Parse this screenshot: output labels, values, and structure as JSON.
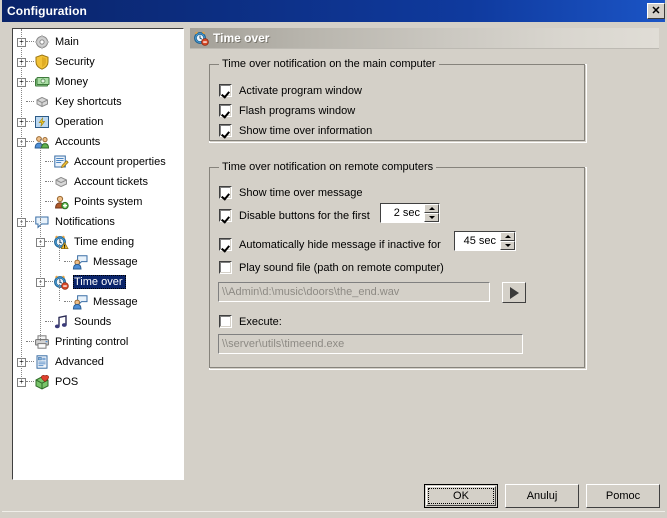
{
  "window": {
    "title": "Configuration",
    "close_label": "✕"
  },
  "tree": {
    "items": [
      {
        "label": "Main",
        "indent": 0,
        "expander": "+",
        "icon": "gear-icon",
        "selected": false
      },
      {
        "label": "Security",
        "indent": 0,
        "expander": "+",
        "icon": "shield-icon",
        "selected": false
      },
      {
        "label": "Money",
        "indent": 0,
        "expander": "+",
        "icon": "money-icon",
        "selected": false
      },
      {
        "label": "Key shortcuts",
        "indent": 0,
        "expander": "",
        "icon": "keyboard-icon",
        "selected": false
      },
      {
        "label": "Operation",
        "indent": 0,
        "expander": "+",
        "icon": "lightning-icon",
        "selected": false
      },
      {
        "label": "Accounts",
        "indent": 0,
        "expander": "-",
        "icon": "users-icon",
        "selected": false
      },
      {
        "label": "Account properties",
        "indent": 1,
        "expander": "",
        "icon": "edit-document-icon",
        "selected": false
      },
      {
        "label": "Account tickets",
        "indent": 1,
        "expander": "",
        "icon": "ticket-icon",
        "selected": false
      },
      {
        "label": "Points system",
        "indent": 1,
        "expander": "",
        "icon": "user-add-icon",
        "selected": false
      },
      {
        "label": "Notifications",
        "indent": 0,
        "expander": "-",
        "icon": "speech-bubble-icon",
        "selected": false
      },
      {
        "label": "Time ending",
        "indent": 1,
        "expander": "-",
        "icon": "alarm-warning-icon",
        "selected": false
      },
      {
        "label": "Message",
        "indent": 2,
        "expander": "",
        "icon": "user-message-icon",
        "selected": false
      },
      {
        "label": "Time over",
        "indent": 1,
        "expander": "-",
        "icon": "alarm-stop-icon",
        "selected": true
      },
      {
        "label": "Message",
        "indent": 2,
        "expander": "",
        "icon": "user-message-icon",
        "selected": false
      },
      {
        "label": "Sounds",
        "indent": 1,
        "expander": "",
        "icon": "music-note-icon",
        "selected": false
      },
      {
        "label": "Printing control",
        "indent": 0,
        "expander": "",
        "icon": "printer-icon",
        "selected": false
      },
      {
        "label": "Advanced",
        "indent": 0,
        "expander": "+",
        "icon": "advanced-list-icon",
        "selected": false
      },
      {
        "label": "POS",
        "indent": 0,
        "expander": "+",
        "icon": "pos-box-icon",
        "selected": false
      }
    ]
  },
  "pane": {
    "header_title": "Time over",
    "header_icon": "alarm-stop-icon",
    "group_main": {
      "title": "Time over notification on the main computer",
      "options": [
        {
          "label": "Activate program window",
          "checked": true
        },
        {
          "label": "Flash programs window",
          "checked": true
        },
        {
          "label": "Show time over information",
          "checked": true
        }
      ]
    },
    "group_remote": {
      "title": "Time over notification on remote computers",
      "show_message": {
        "label": "Show time over message",
        "checked": true
      },
      "disable_buttons": {
        "label": "Disable buttons for the first",
        "checked": true,
        "value": "2 sec"
      },
      "auto_hide": {
        "label": "Automatically hide message if inactive for",
        "checked": true,
        "value": "45 sec"
      },
      "play_sound": {
        "label": "Play sound file (path on remote computer)",
        "checked": false,
        "value": "\\\\Admin\\d:\\music\\doors\\the_end.wav"
      },
      "play_button_icon": "play-icon",
      "execute": {
        "label": "Execute:",
        "checked": false,
        "value": "\\\\server\\utils\\timeend.exe"
      }
    }
  },
  "footer": {
    "ok_label": "OK",
    "cancel_label": "Anuluj",
    "help_label": "Pomoc"
  },
  "colors": {
    "titlebar_start": "#0a246a",
    "titlebar_end": "#1b55c6",
    "face": "#d4d0c8",
    "selection": "#0a246a",
    "disabled_text": "#8d8a84"
  }
}
